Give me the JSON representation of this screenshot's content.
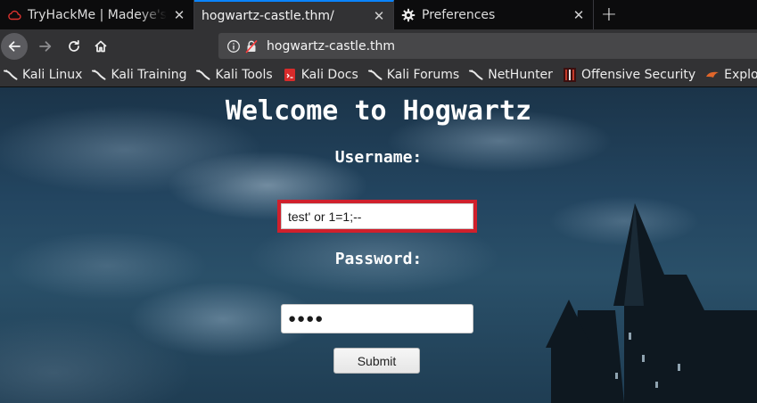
{
  "tabs": [
    {
      "title": "TryHackMe | Madeye's Castle",
      "icon": "tryhackme-cloud-icon"
    },
    {
      "title": "hogwartz-castle.thm/",
      "icon": ""
    },
    {
      "title": "Preferences",
      "icon": "gear-icon"
    }
  ],
  "navbar": {
    "url": "hogwartz-castle.thm"
  },
  "bookmarks": [
    {
      "label": "Kali Linux",
      "icon": "kali-dragon-icon"
    },
    {
      "label": "Kali Training",
      "icon": "kali-dragon-icon"
    },
    {
      "label": "Kali Tools",
      "icon": "kali-dragon-icon"
    },
    {
      "label": "Kali Docs",
      "icon": "kali-docs-icon"
    },
    {
      "label": "Kali Forums",
      "icon": "kali-dragon-icon"
    },
    {
      "label": "NetHunter",
      "icon": "kali-dragon-icon"
    },
    {
      "label": "Offensive Security",
      "icon": "offsec-icon"
    },
    {
      "label": "Exploit-DB",
      "icon": "exploit-db-icon"
    }
  ],
  "page": {
    "title": "Welcome to Hogwartz",
    "username_label": "Username:",
    "username_value": "test' or 1=1;--",
    "password_label": "Password:",
    "password_value": "●●●●",
    "submit_label": "Submit"
  },
  "colors": {
    "accent_tab": "#0a84ff",
    "highlight_border": "#d0202c",
    "toolbar_bg": "#323234"
  }
}
